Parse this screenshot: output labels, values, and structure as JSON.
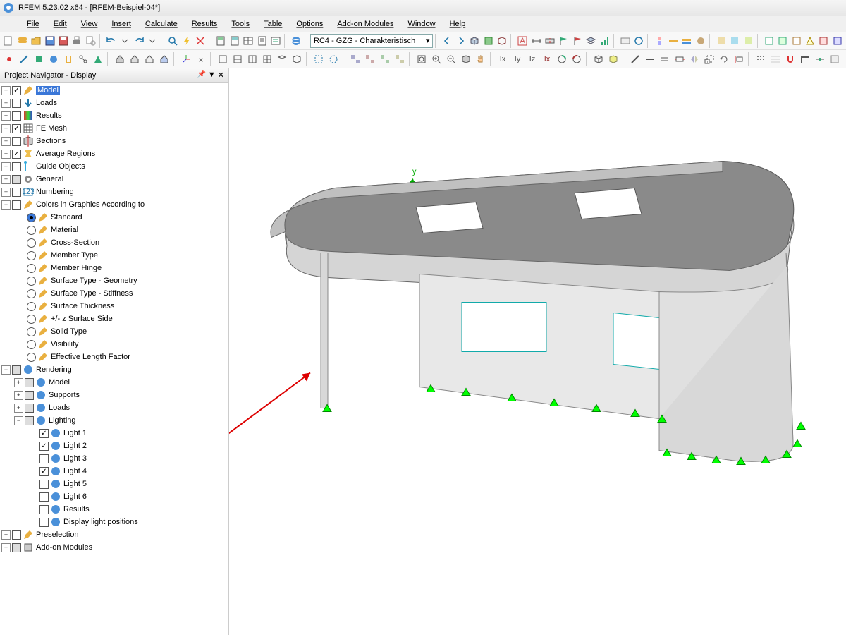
{
  "title": "RFEM 5.23.02 x64 - [RFEM-Beispiel-04*]",
  "menu": [
    "File",
    "Edit",
    "View",
    "Insert",
    "Calculate",
    "Results",
    "Tools",
    "Table",
    "Options",
    "Add-on Modules",
    "Window",
    "Help"
  ],
  "combo": "RC4 - GZG - Charakteristisch",
  "nav_title": "Project Navigator - Display",
  "tree": {
    "model": "Model",
    "loads": "Loads",
    "results": "Results",
    "femesh": "FE Mesh",
    "sections": "Sections",
    "avgreg": "Average Regions",
    "guide": "Guide Objects",
    "general": "General",
    "numbering": "Numbering",
    "colors": "Colors in Graphics According to",
    "c_std": "Standard",
    "c_mat": "Material",
    "c_cs": "Cross-Section",
    "c_mt": "Member Type",
    "c_mh": "Member Hinge",
    "c_stg": "Surface Type - Geometry",
    "c_sts": "Surface Type - Stiffness",
    "c_stk": "Surface Thickness",
    "c_zs": "+/- z Surface Side",
    "c_sol": "Solid Type",
    "c_vis": "Visibility",
    "c_elf": "Effective Length Factor",
    "rendering": "Rendering",
    "r_model": "Model",
    "r_supports": "Supports",
    "r_loads": "Loads",
    "lighting": "Lighting",
    "l1": "Light 1",
    "l2": "Light 2",
    "l3": "Light 3",
    "l4": "Light 4",
    "l5": "Light 5",
    "l6": "Light 6",
    "l_res": "Results",
    "l_pos": "Display light positions",
    "presel": "Preselection",
    "addon": "Add-on Modules"
  }
}
